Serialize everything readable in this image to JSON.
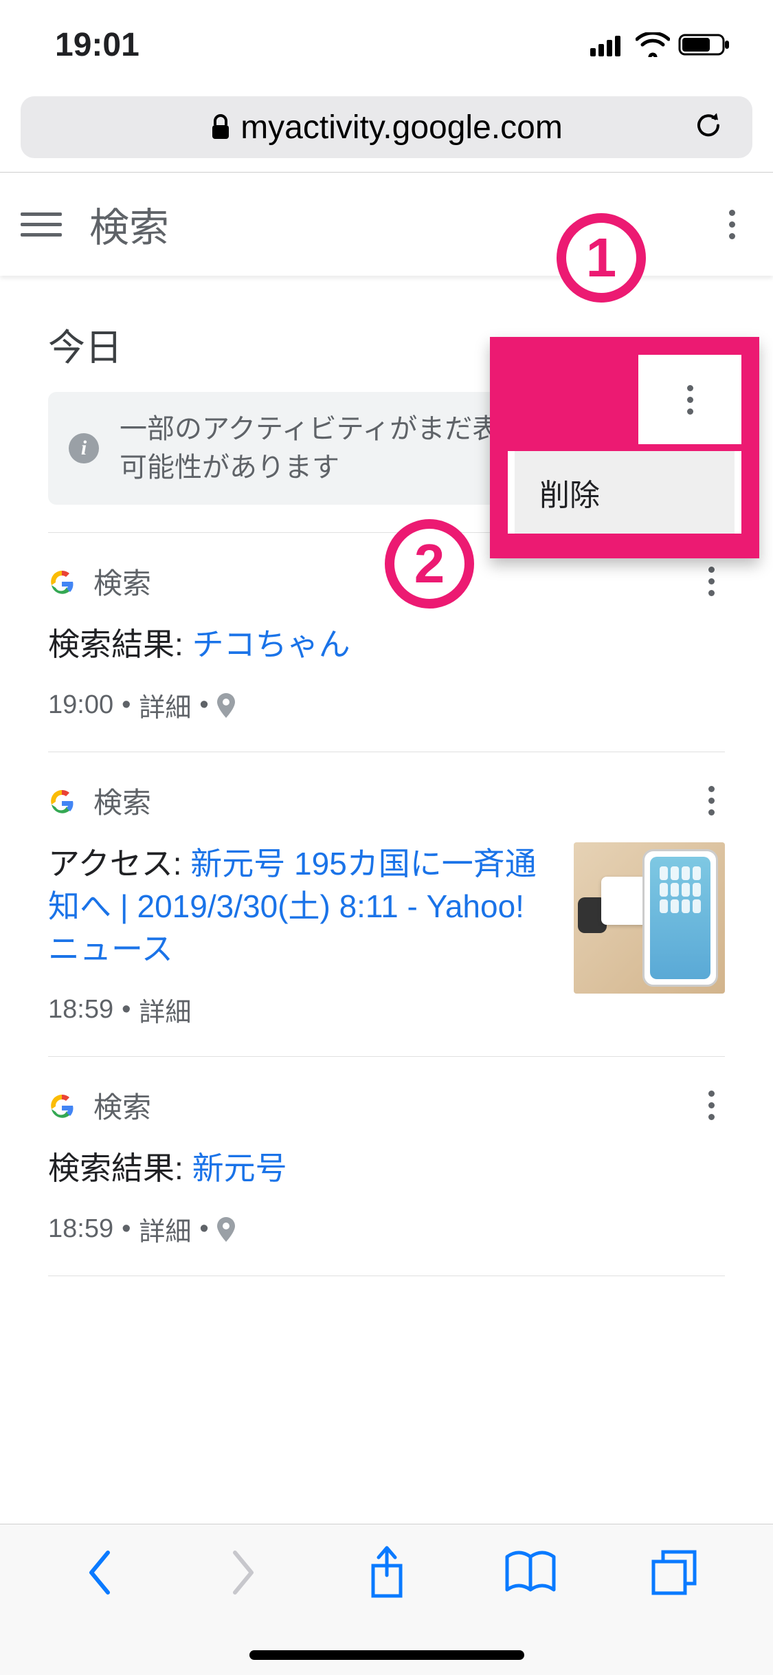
{
  "status": {
    "time": "19:01"
  },
  "browser": {
    "url_display": "myactivity.google.com"
  },
  "header": {
    "title": "検索"
  },
  "section": {
    "title": "今日"
  },
  "banner": {
    "text": "一部のアクティビティがまだ表示されていない可能性があります"
  },
  "popup": {
    "delete_label": "削除"
  },
  "annotations": {
    "one": "1",
    "two": "2"
  },
  "items": [
    {
      "category": "検索",
      "prefix": "検索結果: ",
      "link_text": "チコちゃん",
      "time": "19:00",
      "details_label": "詳細",
      "has_location": true,
      "has_thumb": false
    },
    {
      "category": "検索",
      "prefix": "アクセス: ",
      "link_text": "新元号 195カ国に一斉通知へ | 2019/3/30(土) 8:11 - Yahoo!ニュース",
      "time": "18:59",
      "details_label": "詳細",
      "has_location": false,
      "has_thumb": true
    },
    {
      "category": "検索",
      "prefix": "検索結果: ",
      "link_text": "新元号",
      "time": "18:59",
      "details_label": "詳細",
      "has_location": true,
      "has_thumb": false
    }
  ],
  "colors": {
    "accent_pink": "#ec1a72",
    "link_blue": "#1a73e8"
  }
}
